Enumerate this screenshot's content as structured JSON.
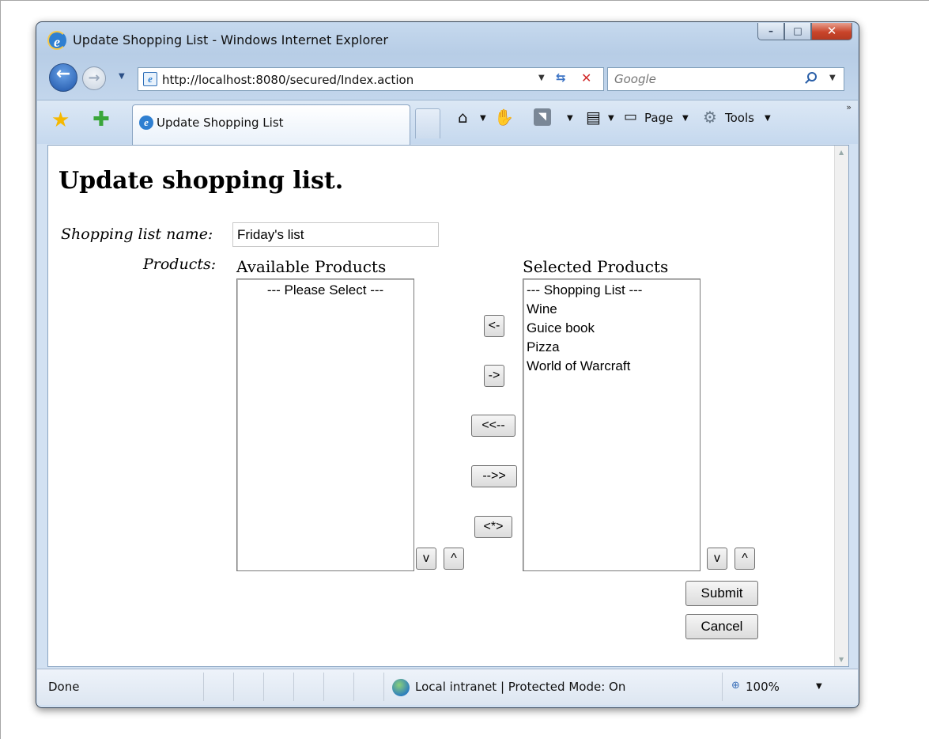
{
  "window": {
    "title": "Update Shopping List - Windows Internet Explorer",
    "minimize": "–",
    "maximize": "□",
    "close": "✕"
  },
  "nav": {
    "back_icon": "back-arrow-icon",
    "forward_icon": "forward-arrow-icon",
    "url": "http://localhost:8080/secured/Index.action",
    "search_placeholder": "Google"
  },
  "toolbar": {
    "tab_label": "Update Shopping List",
    "page_menu": "Page",
    "tools_menu": "Tools"
  },
  "page": {
    "heading": "Update shopping list.",
    "name_label": "Shopping list name:",
    "name_value": "Friday's list",
    "products_label": "Products:",
    "available_heading": "Available Products",
    "selected_heading": "Selected Products",
    "available_items": [
      "--- Please Select ---"
    ],
    "selected_items": [
      "--- Shopping List ---",
      "Wine",
      "Guice book",
      "Pizza",
      "World of Warcraft"
    ],
    "buttons": {
      "move_left": "<-",
      "move_right": "->",
      "move_all_left": "<<--",
      "move_all_right": "-->>",
      "swap": "<*>",
      "available_down": "v",
      "available_up": "^",
      "selected_down": "v",
      "selected_up": "^",
      "submit": "Submit",
      "cancel": "Cancel"
    }
  },
  "status": {
    "text": "Done",
    "zone": "Local intranet | Protected Mode: On",
    "zoom": "100%"
  }
}
